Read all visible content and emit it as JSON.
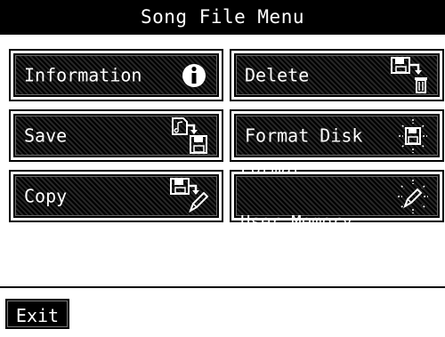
{
  "title": "Song File Menu",
  "buttons": {
    "information": {
      "label": "Information",
      "icon": "info-icon"
    },
    "delete": {
      "label": "Delete",
      "icon": "delete-file-icon"
    },
    "save": {
      "label": "Save",
      "icon": "save-file-icon"
    },
    "format_disk": {
      "label": "Format Disk",
      "icon": "format-disk-icon"
    },
    "copy": {
      "label": "Copy",
      "icon": "copy-file-icon"
    },
    "format_user_memory": {
      "line1": "Format",
      "line2": "User Memory",
      "icon": "format-memory-icon"
    }
  },
  "exit_label": "Exit"
}
